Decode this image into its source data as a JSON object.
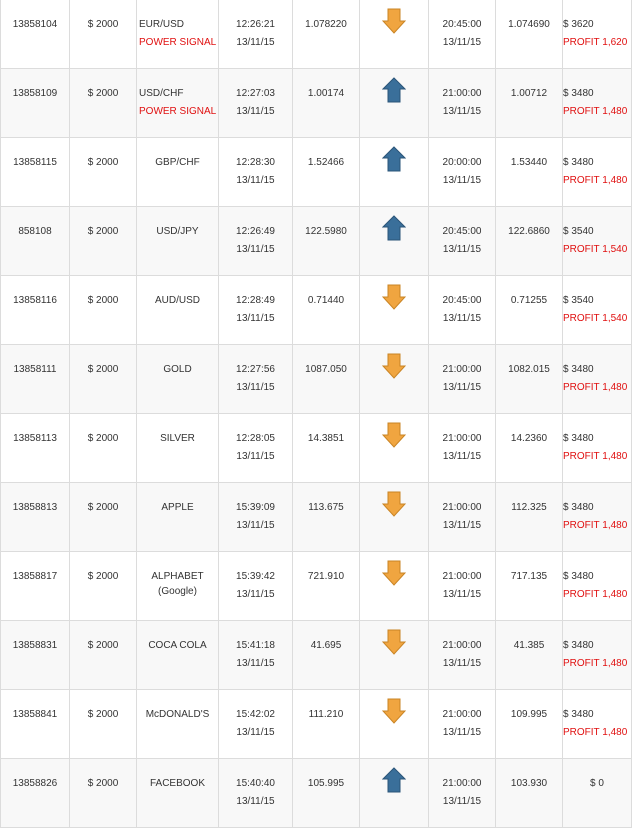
{
  "trades": [
    {
      "id": "13858104",
      "amount": "$ 2000",
      "symbol": "EUR/USD",
      "symbol_sub": "",
      "signal": "POWER SIGNAL",
      "open_time": "12:26:21",
      "open_date": "13/11/15",
      "open_price": "1.078220",
      "direction": "down",
      "close_time": "20:45:00",
      "close_date": "13/11/15",
      "close_price": "1.074690",
      "payout": "$ 3620",
      "profit": "PROFIT 1,620"
    },
    {
      "id": "13858109",
      "amount": "$ 2000",
      "symbol": "USD/CHF",
      "symbol_sub": "",
      "signal": "POWER SIGNAL",
      "open_time": "12:27:03",
      "open_date": "13/11/15",
      "open_price": "1.00174",
      "direction": "up",
      "close_time": "21:00:00",
      "close_date": "13/11/15",
      "close_price": "1.00712",
      "payout": "$ 3480",
      "profit": "PROFIT 1,480"
    },
    {
      "id": "13858115",
      "amount": "$ 2000",
      "symbol": "GBP/CHF",
      "symbol_sub": "",
      "signal": "",
      "open_time": "12:28:30",
      "open_date": "13/11/15",
      "open_price": "1.52466",
      "direction": "up",
      "close_time": "20:00:00",
      "close_date": "13/11/15",
      "close_price": "1.53440",
      "payout": "$ 3480",
      "profit": "PROFIT 1,480"
    },
    {
      "id": "858108",
      "amount": "$ 2000",
      "symbol": "USD/JPY",
      "symbol_sub": "",
      "signal": "",
      "open_time": "12:26:49",
      "open_date": "13/11/15",
      "open_price": "122.5980",
      "direction": "up",
      "close_time": "20:45:00",
      "close_date": "13/11/15",
      "close_price": "122.6860",
      "payout": "$ 3540",
      "profit": "PROFIT 1,540"
    },
    {
      "id": "13858116",
      "amount": "$ 2000",
      "symbol": "AUD/USD",
      "symbol_sub": "",
      "signal": "",
      "open_time": "12:28:49",
      "open_date": "13/11/15",
      "open_price": "0.71440",
      "direction": "down",
      "close_time": "20:45:00",
      "close_date": "13/11/15",
      "close_price": "0.71255",
      "payout": "$ 3540",
      "profit": "PROFIT 1,540"
    },
    {
      "id": "13858111",
      "amount": "$ 2000",
      "symbol": "GOLD",
      "symbol_sub": "",
      "signal": "",
      "open_time": "12:27:56",
      "open_date": "13/11/15",
      "open_price": "1087.050",
      "direction": "down",
      "close_time": "21:00:00",
      "close_date": "13/11/15",
      "close_price": "1082.015",
      "payout": "$ 3480",
      "profit": "PROFIT 1,480"
    },
    {
      "id": "13858113",
      "amount": "$ 2000",
      "symbol": "SILVER",
      "symbol_sub": "",
      "signal": "",
      "open_time": "12:28:05",
      "open_date": "13/11/15",
      "open_price": "14.3851",
      "direction": "down",
      "close_time": "21:00:00",
      "close_date": "13/11/15",
      "close_price": "14.2360",
      "payout": "$ 3480",
      "profit": "PROFIT 1,480"
    },
    {
      "id": "13858813",
      "amount": "$ 2000",
      "symbol": "APPLE",
      "symbol_sub": "",
      "signal": "",
      "open_time": "15:39:09",
      "open_date": "13/11/15",
      "open_price": "113.675",
      "direction": "down",
      "close_time": "21:00:00",
      "close_date": "13/11/15",
      "close_price": "112.325",
      "payout": "$ 3480",
      "profit": "PROFIT 1,480"
    },
    {
      "id": "13858817",
      "amount": "$ 2000",
      "symbol": "ALPHABET",
      "symbol_sub": "(Google)",
      "signal": "",
      "open_time": "15:39:42",
      "open_date": "13/11/15",
      "open_price": "721.910",
      "direction": "down",
      "close_time": "21:00:00",
      "close_date": "13/11/15",
      "close_price": "717.135",
      "payout": "$ 3480",
      "profit": "PROFIT 1,480"
    },
    {
      "id": "13858831",
      "amount": "$ 2000",
      "symbol": "COCA COLA",
      "symbol_sub": "",
      "signal": "",
      "open_time": "15:41:18",
      "open_date": "13/11/15",
      "open_price": "41.695",
      "direction": "down",
      "close_time": "21:00:00",
      "close_date": "13/11/15",
      "close_price": "41.385",
      "payout": "$ 3480",
      "profit": "PROFIT 1,480"
    },
    {
      "id": "13858841",
      "amount": "$ 2000",
      "symbol": "McDONALD'S",
      "symbol_sub": "",
      "signal": "",
      "open_time": "15:42:02",
      "open_date": "13/11/15",
      "open_price": "111.210",
      "direction": "down",
      "close_time": "21:00:00",
      "close_date": "13/11/15",
      "close_price": "109.995",
      "payout": "$ 3480",
      "profit": "PROFIT 1,480"
    },
    {
      "id": "13858826",
      "amount": "$ 2000",
      "symbol": "FACEBOOK",
      "symbol_sub": "",
      "signal": "",
      "open_time": "15:40:40",
      "open_date": "13/11/15",
      "open_price": "105.995",
      "direction": "up",
      "close_time": "21:00:00",
      "close_date": "13/11/15",
      "close_price": "103.930",
      "payout": "$ 0",
      "profit": ""
    }
  ],
  "colors": {
    "profit": "#e01010",
    "arrow_down": "#f0a540",
    "arrow_up": "#3a6f9a",
    "border": "#dcdcdc"
  }
}
